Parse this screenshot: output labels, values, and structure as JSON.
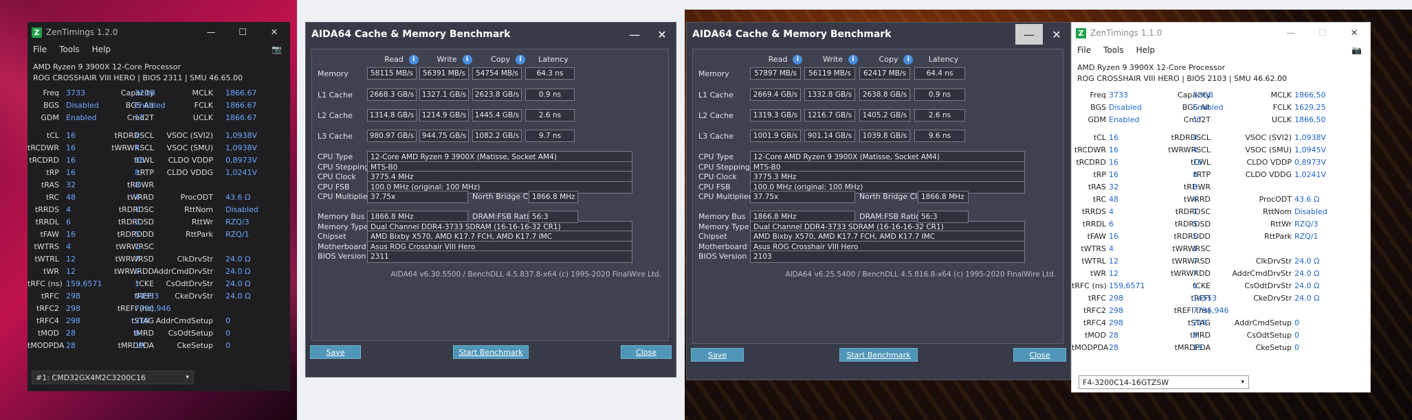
{
  "zen_left": {
    "logo": "Z",
    "title": "ZenTimings 1.2.0",
    "menu": [
      "File",
      "Tools",
      "Help"
    ],
    "cpu": "AMD Ryzen 9 3900X 12-Core Processor",
    "board": "ROG CROSSHAIR VIII HERO | BIOS 2311 | SMU 46.65.00",
    "top": [
      [
        [
          "Freq",
          "3733"
        ],
        [
          "Capacity",
          "32GB"
        ],
        [
          "MCLK",
          "1866.67"
        ]
      ],
      [
        [
          "BGS",
          "Disabled"
        ],
        [
          "BGS Alt",
          "Enabled"
        ],
        [
          "FCLK",
          "1866.67"
        ]
      ],
      [
        [
          "GDM",
          "Enabled"
        ],
        [
          "Cmd2T",
          "1T"
        ],
        [
          "UCLK",
          "1866.67"
        ]
      ]
    ],
    "timings": [
      [
        [
          "tCL",
          "16"
        ],
        [
          "tRDRDSCL",
          "4"
        ],
        [
          "VSOC (SVI2)",
          "1,0938V"
        ]
      ],
      [
        [
          "tRCDWR",
          "16"
        ],
        [
          "tWRWRSCL",
          "4"
        ],
        [
          "VSOC (SMU)",
          "1,0938V"
        ]
      ],
      [
        [
          "tRCDRD",
          "16"
        ],
        [
          "tCWL",
          "16"
        ],
        [
          "CLDO VDDP",
          "0,8973V"
        ]
      ],
      [
        [
          "tRP",
          "16"
        ],
        [
          "tRTP",
          "8"
        ],
        [
          "CLDO VDDG",
          "1,0241V"
        ]
      ],
      [
        [
          "tRAS",
          "32"
        ],
        [
          "tRDWR",
          "8"
        ],
        [
          "",
          ""
        ]
      ],
      [
        [
          "tRC",
          "48"
        ],
        [
          "tWRRD",
          "4"
        ],
        [
          "ProcODT",
          "43.6 Ω"
        ]
      ],
      [
        [
          "tRRDS",
          "4"
        ],
        [
          "tRDRDSC",
          "1"
        ],
        [
          "RttNom",
          "Disabled"
        ]
      ],
      [
        [
          "tRRDL",
          "6"
        ],
        [
          "tRDRDSD",
          "5"
        ],
        [
          "RttWr",
          "RZQ/3"
        ]
      ],
      [
        [
          "tFAW",
          "16"
        ],
        [
          "tRDRDDD",
          "5"
        ],
        [
          "RttPark",
          "RZQ/1"
        ]
      ],
      [
        [
          "tWTRS",
          "4"
        ],
        [
          "tWRWRSC",
          "1"
        ],
        [
          "",
          ""
        ]
      ],
      [
        [
          "tWTRL",
          "12"
        ],
        [
          "tWRWRSD",
          "7"
        ],
        [
          "ClkDrvStr",
          "24.0 Ω"
        ]
      ],
      [
        [
          "tWR",
          "12"
        ],
        [
          "tWRWRDD",
          "7"
        ],
        [
          "AddrCmdDrvStr",
          "24.0 Ω"
        ]
      ],
      [
        [
          "tRFC (ns)",
          "159,6571"
        ],
        [
          "tCKE",
          "1"
        ],
        [
          "CsOdtDrvStr",
          "24.0 Ω"
        ]
      ],
      [
        [
          "tRFC",
          "298"
        ],
        [
          "tREFI",
          "14553"
        ],
        [
          "CkeDrvStr",
          "24.0 Ω"
        ]
      ],
      [
        [
          "tRFC2",
          "298"
        ],
        [
          "tREFI (ns)",
          "7796,946"
        ],
        [
          "",
          ""
        ]
      ],
      [
        [
          "tRFC4",
          "298"
        ],
        [
          "tSTAG",
          "218"
        ],
        [
          "AddrCmdSetup",
          "0"
        ]
      ],
      [
        [
          "tMOD",
          "28"
        ],
        [
          "tMRD",
          "8"
        ],
        [
          "CsOdtSetup",
          "0"
        ]
      ],
      [
        [
          "tMODPDA",
          "28"
        ],
        [
          "tMRDPDA",
          "19"
        ],
        [
          "CkeSetup",
          "0"
        ]
      ]
    ],
    "dimm": "#1: CMD32GX4M2C3200C16"
  },
  "zen_right": {
    "logo": "Z",
    "title": "ZenTimings 1.1.0",
    "menu": [
      "File",
      "Tools",
      "Help"
    ],
    "cpu": "AMD Ryzen 9 3900X 12-Core Processor",
    "board": "ROG CROSSHAIR VIII HERO | BIOS 2103 | SMU 46.62.00",
    "top": [
      [
        [
          "Freq",
          "3733"
        ],
        [
          "Capacity",
          "32GB"
        ],
        [
          "MCLK",
          "1866,50"
        ]
      ],
      [
        [
          "BGS",
          "Disabled"
        ],
        [
          "BGS Alt",
          "Enabled"
        ],
        [
          "FCLK",
          "1629,25"
        ]
      ],
      [
        [
          "GDM",
          "Enabled"
        ],
        [
          "Cmd2T",
          "1T"
        ],
        [
          "UCLK",
          "1866,50"
        ]
      ]
    ],
    "timings": [
      [
        [
          "tCL",
          "16"
        ],
        [
          "tRDRDSCL",
          "4"
        ],
        [
          "VSOC (SVI2)",
          "1,0938V"
        ]
      ],
      [
        [
          "tRCDWR",
          "16"
        ],
        [
          "tWRWRSCL",
          "4"
        ],
        [
          "VSOC (SMU)",
          "1,0945V"
        ]
      ],
      [
        [
          "tRCDRD",
          "16"
        ],
        [
          "tCWL",
          "16"
        ],
        [
          "CLDO VDDP",
          "0,8973V"
        ]
      ],
      [
        [
          "tRP",
          "16"
        ],
        [
          "tRTP",
          "8"
        ],
        [
          "CLDO VDDG",
          "1,0241V"
        ]
      ],
      [
        [
          "tRAS",
          "32"
        ],
        [
          "tRDWR",
          "8"
        ],
        [
          "",
          ""
        ]
      ],
      [
        [
          "tRC",
          "48"
        ],
        [
          "tWRRD",
          "4"
        ],
        [
          "ProcODT",
          "43.6 Ω"
        ]
      ],
      [
        [
          "tRRDS",
          "4"
        ],
        [
          "tRDRDSC",
          "1"
        ],
        [
          "RttNom",
          "Disabled"
        ]
      ],
      [
        [
          "tRRDL",
          "6"
        ],
        [
          "tRDRDSD",
          "5"
        ],
        [
          "RttWr",
          "RZQ/3"
        ]
      ],
      [
        [
          "tFAW",
          "16"
        ],
        [
          "tRDRDDD",
          "5"
        ],
        [
          "RttPark",
          "RZQ/1"
        ]
      ],
      [
        [
          "tWTRS",
          "4"
        ],
        [
          "tWRWRSC",
          "1"
        ],
        [
          "",
          ""
        ]
      ],
      [
        [
          "tWTRL",
          "12"
        ],
        [
          "tWRWRSD",
          "7"
        ],
        [
          "ClkDrvStr",
          "24.0 Ω"
        ]
      ],
      [
        [
          "tWR",
          "12"
        ],
        [
          "tWRWRDD",
          "7"
        ],
        [
          "AddrCmdDrvStr",
          "24.0 Ω"
        ]
      ],
      [
        [
          "tRFC (ns)",
          "159,6571"
        ],
        [
          "tCKE",
          "1"
        ],
        [
          "CsOdtDrvStr",
          "24.0 Ω"
        ]
      ],
      [
        [
          "tRFC",
          "298"
        ],
        [
          "tREFI",
          "14553"
        ],
        [
          "CkeDrvStr",
          "24.0 Ω"
        ]
      ],
      [
        [
          "tRFC2",
          "298"
        ],
        [
          "tREFI (ns)",
          "7796,946"
        ],
        [
          "",
          ""
        ]
      ],
      [
        [
          "tRFC4",
          "298"
        ],
        [
          "tSTAG",
          "218"
        ],
        [
          "AddrCmdSetup",
          "0"
        ]
      ],
      [
        [
          "tMOD",
          "28"
        ],
        [
          "tMRD",
          "8"
        ],
        [
          "CsOdtSetup",
          "0"
        ]
      ],
      [
        [
          "tMODPDA",
          "28"
        ],
        [
          "tMRDPDA",
          "19"
        ],
        [
          "CkeSetup",
          "0"
        ]
      ]
    ],
    "dimm": "F4-3200C14-16GTZSW"
  },
  "aida_left": {
    "title": "AIDA64 Cache & Memory Benchmark",
    "headers": [
      "Read",
      "Write",
      "Copy",
      "Latency"
    ],
    "rows": [
      [
        "Memory",
        "58115 MB/s",
        "56391 MB/s",
        "54754 MB/s",
        "64.3 ns"
      ],
      [
        "L1 Cache",
        "2668.3 GB/s",
        "1327.1 GB/s",
        "2623.8 GB/s",
        "0.9 ns"
      ],
      [
        "L2 Cache",
        "1314.8 GB/s",
        "1214.9 GB/s",
        "1445.4 GB/s",
        "2.6 ns"
      ],
      [
        "L3 Cache",
        "980.97 GB/s",
        "944.75 GB/s",
        "1082.2 GB/s",
        "9.7 ns"
      ]
    ],
    "cpu": {
      "type_label": "CPU Type",
      "type": "12-Core AMD Ryzen 9 3900X  (Matisse, Socket AM4)",
      "stepping_label": "CPU Stepping",
      "stepping": "MTS-B0",
      "clock_label": "CPU Clock",
      "clock": "3775.4 MHz",
      "fsb_label": "CPU FSB",
      "fsb": "100.0 MHz  (original: 100 MHz)",
      "mult_label": "CPU Multiplier",
      "mult": "37.75x",
      "nb_label": "North Bridge Clock",
      "nb": "1866.8 MHz"
    },
    "mem": {
      "bus_label": "Memory Bus",
      "bus": "1866.8 MHz",
      "ratio_label": "DRAM:FSB Ratio",
      "ratio": "56:3",
      "type_label": "Memory Type",
      "type": "Dual Channel DDR4-3733 SDRAM  (16-16-16-32 CR1)",
      "chipset_label": "Chipset",
      "chipset": "AMD Bixby X570, AMD K17.7 FCH, AMD K17.7 IMC",
      "mobo_label": "Motherboard",
      "mobo": "Asus ROG Crosshair VIII Hero",
      "bios_label": "BIOS Version",
      "bios": "2311"
    },
    "footer": "AIDA64 v6.30.5500 / BenchDLL 4.5.837.8-x64  (c) 1995-2020 FinalWire Ltd.",
    "save": "Save",
    "start": "Start Benchmark",
    "close": "Close"
  },
  "aida_right": {
    "title": "AIDA64 Cache & Memory Benchmark",
    "headers": [
      "Read",
      "Write",
      "Copy",
      "Latency"
    ],
    "rows": [
      [
        "Memory",
        "57897 MB/s",
        "56119 MB/s",
        "62417 MB/s",
        "64.4 ns"
      ],
      [
        "L1 Cache",
        "2669.4 GB/s",
        "1332.8 GB/s",
        "2638.8 GB/s",
        "0.9 ns"
      ],
      [
        "L2 Cache",
        "1319.3 GB/s",
        "1216.7 GB/s",
        "1405.2 GB/s",
        "2.6 ns"
      ],
      [
        "L3 Cache",
        "1001.9 GB/s",
        "901.14 GB/s",
        "1039.8 GB/s",
        "9.6 ns"
      ]
    ],
    "cpu": {
      "type_label": "CPU Type",
      "type": "12-Core AMD Ryzen 9 3900X  (Matisse, Socket AM4)",
      "stepping_label": "CPU Stepping",
      "stepping": "MTS-B0",
      "clock_label": "CPU Clock",
      "clock": "3775.3 MHz",
      "fsb_label": "CPU FSB",
      "fsb": "100.0 MHz  (original: 100 MHz)",
      "mult_label": "CPU Multiplier",
      "mult": "37.75x",
      "nb_label": "North Bridge Clock",
      "nb": "1866.8 MHz"
    },
    "mem": {
      "bus_label": "Memory Bus",
      "bus": "1866.8 MHz",
      "ratio_label": "DRAM:FSB Ratio",
      "ratio": "56:3",
      "type_label": "Memory Type",
      "type": "Dual Channel DDR4-3733 SDRAM  (16-16-16-32 CR1)",
      "chipset_label": "Chipset",
      "chipset": "AMD Bixby X570, AMD K17.7 FCH, AMD K17.7 IMC",
      "mobo_label": "Motherboard",
      "mobo": "Asus ROG Crosshair VIII Hero",
      "bios_label": "BIOS Version",
      "bios": "2103"
    },
    "footer": "AIDA64 v6.25.5400 / BenchDLL 4.5.816.8-x64  (c) 1995-2020 FinalWire Ltd.",
    "save": "Save",
    "start": "Start Benchmark",
    "close": "Close"
  },
  "icons": {
    "minimize": "—",
    "maximize": "☐",
    "close": "✕",
    "info": "i",
    "camera": "📷",
    "dropdown": "▾"
  }
}
